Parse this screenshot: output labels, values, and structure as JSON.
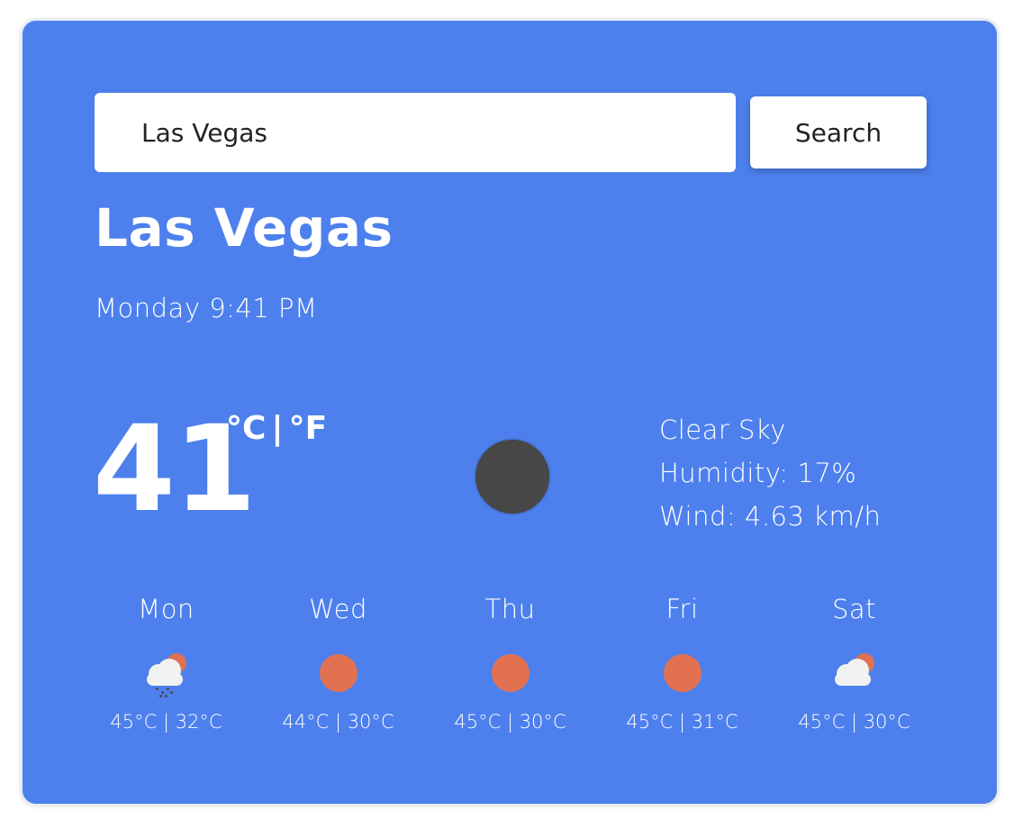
{
  "theme": {
    "card_bg": "#4d80ed",
    "sun_color": "#e27152",
    "main_icon_color": "#474747"
  },
  "search": {
    "value": "Las Vegas",
    "placeholder": "",
    "button_label": "Search"
  },
  "weather": {
    "city": "Las Vegas",
    "datetime": "Monday 9:41 PM",
    "temperature": "41",
    "unit_celsius": "°C",
    "unit_separator": "|",
    "unit_fahrenheit": "°F",
    "main_icon": "dark-circle-icon",
    "description": "Clear Sky",
    "humidity": "Humidity: 17%",
    "wind": "Wind: 4.63 km/h"
  },
  "forecast": [
    {
      "day": "Mon",
      "icon": "cloud-rain-sun-icon",
      "range": "45°C | 32°C"
    },
    {
      "day": "Wed",
      "icon": "sun-icon",
      "range": "44°C | 30°C"
    },
    {
      "day": "Thu",
      "icon": "sun-icon",
      "range": "45°C | 30°C"
    },
    {
      "day": "Fri",
      "icon": "sun-icon",
      "range": "45°C | 31°C"
    },
    {
      "day": "Sat",
      "icon": "cloud-sun-icon",
      "range": "45°C | 30°C"
    }
  ]
}
